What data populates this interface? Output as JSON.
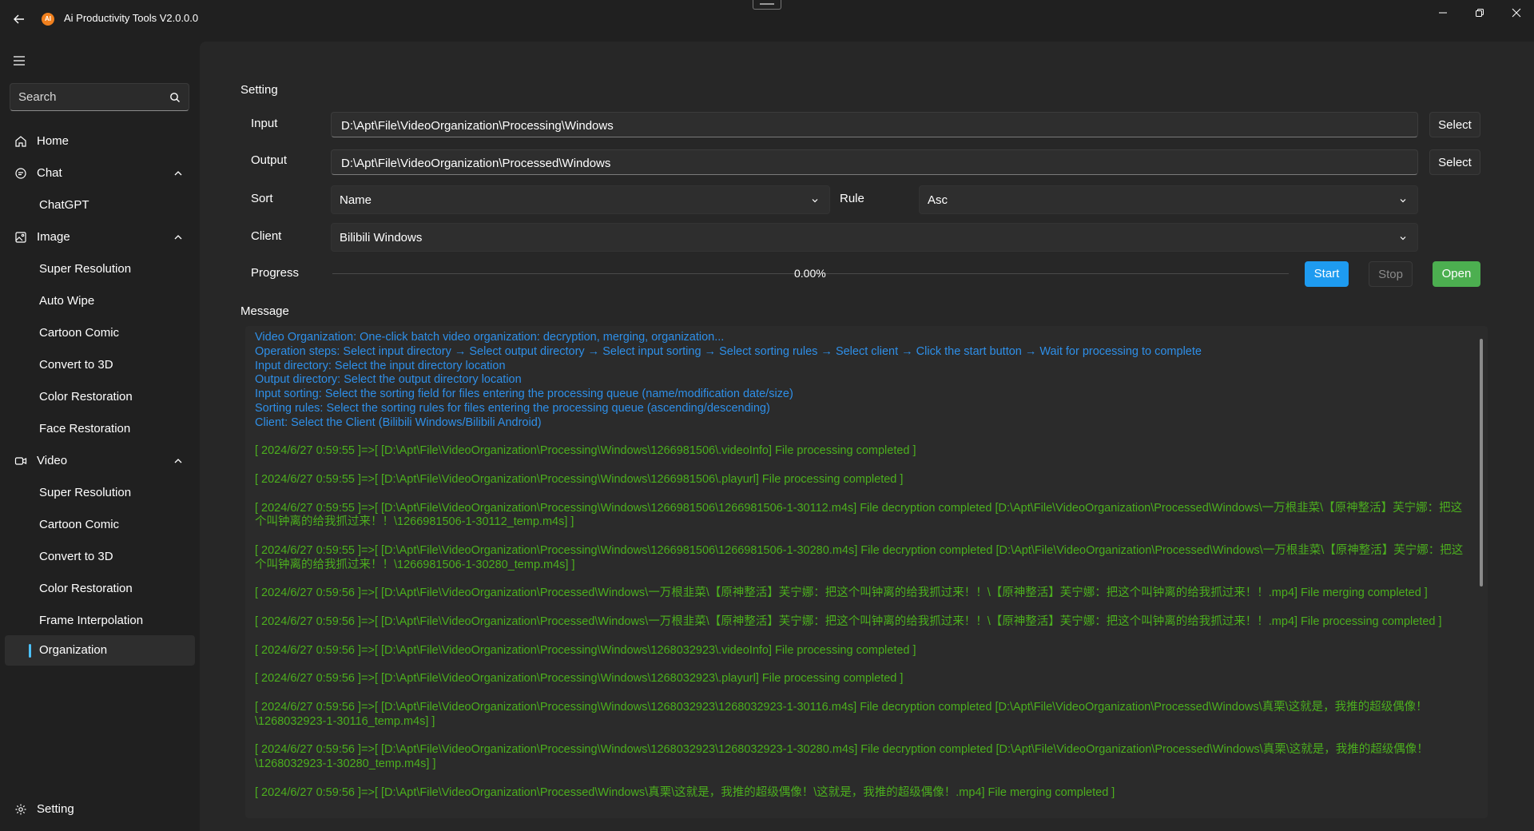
{
  "app": {
    "title": "Ai Productivity Tools V2.0.0.0",
    "logo_text": "AI",
    "logo_color": "#f0801e"
  },
  "sidebar": {
    "search": {
      "placeholder": "Search",
      "value": ""
    },
    "items": [
      {
        "label": "Home",
        "icon": "home-icon"
      },
      {
        "label": "Chat",
        "icon": "chat-icon",
        "expanded": true
      },
      {
        "label": "ChatGPT",
        "sub": true
      },
      {
        "label": "Image",
        "icon": "image-icon",
        "expanded": true
      },
      {
        "label": "Super Resolution",
        "sub": true
      },
      {
        "label": "Auto Wipe",
        "sub": true
      },
      {
        "label": "Cartoon Comic",
        "sub": true
      },
      {
        "label": "Convert to 3D",
        "sub": true
      },
      {
        "label": "Color Restoration",
        "sub": true
      },
      {
        "label": "Face Restoration",
        "sub": true
      },
      {
        "label": "Video",
        "icon": "video-icon",
        "expanded": true
      },
      {
        "label": "Super Resolution",
        "sub": true
      },
      {
        "label": "Cartoon Comic",
        "sub": true
      },
      {
        "label": "Convert to 3D",
        "sub": true
      },
      {
        "label": "Color Restoration",
        "sub": true
      },
      {
        "label": "Frame Interpolation",
        "sub": true
      },
      {
        "label": "Organization",
        "sub": true,
        "selected": true
      }
    ],
    "footer": {
      "label": "Setting",
      "icon": "gear-icon"
    }
  },
  "setting": {
    "title": "Setting",
    "input": {
      "label": "Input",
      "value": "D:\\Apt\\File\\VideoOrganization\\Processing\\Windows",
      "button": "Select"
    },
    "output": {
      "label": "Output",
      "value": "D:\\Apt\\File\\VideoOrganization\\Processed\\Windows",
      "button": "Select"
    },
    "sort": {
      "label": "Sort",
      "value": "Name"
    },
    "rule": {
      "label": "Rule",
      "value": "Asc"
    },
    "client": {
      "label": "Client",
      "value": "Bilibili Windows"
    },
    "progress": {
      "label": "Progress",
      "text": "0.00%",
      "value": 0.0
    },
    "buttons": {
      "start": "Start",
      "stop": "Stop",
      "open": "Open"
    },
    "colors": {
      "start": "#1e9bf0",
      "open": "#4caf50",
      "accent": "#4cc2ff"
    }
  },
  "message": {
    "title": "Message",
    "info_color": "#2e8fe8",
    "log_color": "#4caf1e",
    "info_lines": [
      "Video Organization: One-click batch video organization: decryption, merging, organization...",
      "Operation steps: Select input directory → Select output directory → Select input sorting → Select sorting rules → Select client → Click the start button → Wait for processing to complete",
      "Input directory: Select the input directory location",
      "Output directory: Select the output directory location",
      "Input sorting: Select the sorting field for files entering the processing queue (name/modification date/size)",
      "Sorting rules: Select the sorting rules for files entering the processing queue (ascending/descending)",
      "Client: Select the Client (Bilibili Windows/Bilibili Android)"
    ],
    "log_lines": [
      "[ 2024/6/27 0:59:55 ]=>[ [D:\\Apt\\File\\VideoOrganization\\Processing\\Windows\\1266981506\\.videoInfo] File processing completed ]",
      "[ 2024/6/27 0:59:55 ]=>[ [D:\\Apt\\File\\VideoOrganization\\Processing\\Windows\\1266981506\\.playurl] File processing completed ]",
      "[ 2024/6/27 0:59:55 ]=>[ [D:\\Apt\\File\\VideoOrganization\\Processing\\Windows\\1266981506\\1266981506-1-30112.m4s] File decryption completed [D:\\Apt\\File\\VideoOrganization\\Processed\\Windows\\一万根韭菜\\【原神整活】芙宁娜：把这个叫钟离的给我抓过来！！\\1266981506-1-30112_temp.m4s] ]",
      "[ 2024/6/27 0:59:55 ]=>[ [D:\\Apt\\File\\VideoOrganization\\Processing\\Windows\\1266981506\\1266981506-1-30280.m4s] File decryption completed [D:\\Apt\\File\\VideoOrganization\\Processed\\Windows\\一万根韭菜\\【原神整活】芙宁娜：把这个叫钟离的给我抓过来！！\\1266981506-1-30280_temp.m4s] ]",
      "[ 2024/6/27 0:59:56 ]=>[ [D:\\Apt\\File\\VideoOrganization\\Processed\\Windows\\一万根韭菜\\【原神整活】芙宁娜：把这个叫钟离的给我抓过来！！\\【原神整活】芙宁娜：把这个叫钟离的给我抓过来！！.mp4] File merging completed ]",
      "[ 2024/6/27 0:59:56 ]=>[ [D:\\Apt\\File\\VideoOrganization\\Processed\\Windows\\一万根韭菜\\【原神整活】芙宁娜：把这个叫钟离的给我抓过来！！\\【原神整活】芙宁娜：把这个叫钟离的给我抓过来！！.mp4] File processing completed ]",
      "[ 2024/6/27 0:59:56 ]=>[ [D:\\Apt\\File\\VideoOrganization\\Processing\\Windows\\1268032923\\.videoInfo] File processing completed ]",
      "[ 2024/6/27 0:59:56 ]=>[ [D:\\Apt\\File\\VideoOrganization\\Processing\\Windows\\1268032923\\.playurl] File processing completed ]",
      "[ 2024/6/27 0:59:56 ]=>[ [D:\\Apt\\File\\VideoOrganization\\Processing\\Windows\\1268032923\\1268032923-1-30116.m4s] File decryption completed [D:\\Apt\\File\\VideoOrganization\\Processed\\Windows\\真栗\\这就是，我推的超级偶像！\\1268032923-1-30116_temp.m4s] ]",
      "[ 2024/6/27 0:59:56 ]=>[ [D:\\Apt\\File\\VideoOrganization\\Processing\\Windows\\1268032923\\1268032923-1-30280.m4s] File decryption completed [D:\\Apt\\File\\VideoOrganization\\Processed\\Windows\\真栗\\这就是，我推的超级偶像！\\1268032923-1-30280_temp.m4s] ]",
      "[ 2024/6/27 0:59:56 ]=>[ [D:\\Apt\\File\\VideoOrganization\\Processed\\Windows\\真栗\\这就是，我推的超级偶像！\\这就是，我推的超级偶像！.mp4] File merging completed ]"
    ]
  }
}
